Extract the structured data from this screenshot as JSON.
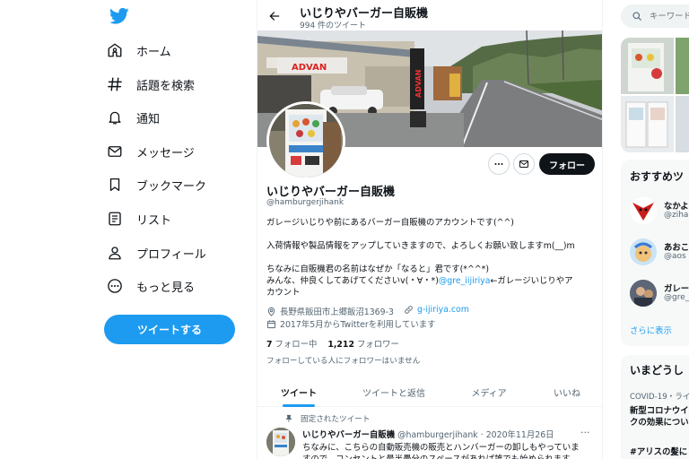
{
  "sidebar": {
    "logo": "twitter-bird-icon",
    "items": [
      {
        "label": "ホーム",
        "icon": "home-icon"
      },
      {
        "label": "話題を検索",
        "icon": "hashtag-icon"
      },
      {
        "label": "通知",
        "icon": "bell-icon"
      },
      {
        "label": "メッセージ",
        "icon": "mail-icon"
      },
      {
        "label": "ブックマーク",
        "icon": "bookmark-icon"
      },
      {
        "label": "リスト",
        "icon": "list-icon"
      },
      {
        "label": "プロフィール",
        "icon": "person-icon"
      },
      {
        "label": "もっと見る",
        "icon": "more-circle-icon"
      }
    ],
    "tweet_button": "ツイートする"
  },
  "profile": {
    "header_title": "いじりやバーガー自販機",
    "tweet_count": "994 件のツイート",
    "banner_sign": "ADVAN",
    "name": "いじりやバーガー自販機",
    "handle": "@hamburgerjihank",
    "follow_button": "フォロー",
    "bio": {
      "line1": "ガレージいじりや前にあるバーガー自販機のアカウントです(^^)",
      "line2": "入荷情報や製品情報をアップしていきますので、よろしくお願い致しますm(__)m",
      "line3": "ちなみに自販機君の名前はなぜか「なると」君です(*^^*)",
      "line4_pre": "みんな、仲良くしてあげてくださいv(・∀・*)",
      "line4_link": "@gre_iijiriya",
      "line4_post": "←ガレージいじりやア",
      "line5": "カウント"
    },
    "location": "長野県飯田市上郷飯沼1369-3",
    "website": "g-ijiriya.com",
    "joined": "2017年5月からTwitterを利用しています",
    "following_count": "7",
    "following_label": "フォロー中",
    "followers_count": "1,212",
    "followers_label": "フォロワー",
    "no_mutual": "フォローしている人にフォロワーはいません"
  },
  "tabs": [
    "ツイート",
    "ツイートと返信",
    "メディア",
    "いいね"
  ],
  "pinned_tweet": {
    "pinned_label": "固定されたツイート",
    "name": "いじりやバーガー自販機",
    "handle": "@hamburgerjihank",
    "date": "· 2020年11月26日",
    "more": "···",
    "text1": "ちなみに、こちらの自動販売機の販売とハンバーガーの卸しもやっていま",
    "text2": "すので、コンセントと最半畳分のスペースがあれば誰でも始められます"
  },
  "right": {
    "search_placeholder": "キーワード検索",
    "recommend_title": "おすすめツ",
    "recommend": [
      {
        "name": "なかよ",
        "handle": "@ziha"
      },
      {
        "name": "あおこ",
        "handle": "@aos"
      },
      {
        "name": "ガレー",
        "handle": "@gre_"
      }
    ],
    "show_more": "さらに表示",
    "trends_title": "いまどうし",
    "trends": [
      {
        "category": "COVID-19・ライ",
        "line1": "新型コロナウイ",
        "line2": "クの効果につい"
      },
      {
        "category": "",
        "line1": "#アリスの髪に",
        "line2": ""
      }
    ]
  },
  "colors": {
    "accent": "#1d9bf0",
    "text": "#0f1419",
    "secondary": "#536471",
    "follow_button": "#0f1419"
  }
}
